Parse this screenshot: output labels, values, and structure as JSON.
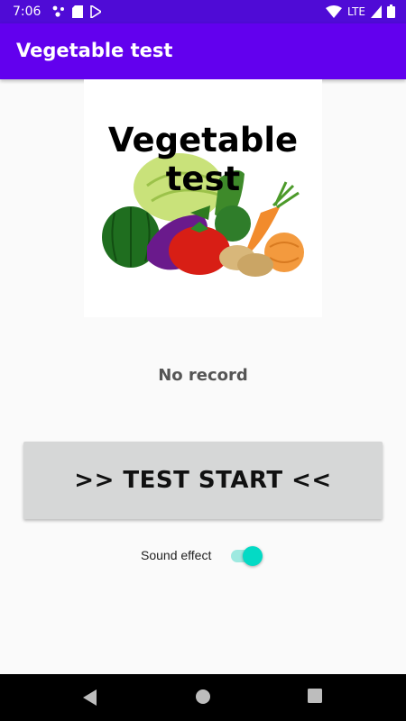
{
  "status_bar": {
    "time": "7:06",
    "network": "LTE"
  },
  "app_bar": {
    "title": "Vegetable test"
  },
  "hero": {
    "title": "Vegetable test"
  },
  "record_text": "No record",
  "start_button": {
    "label": ">> TEST START <<"
  },
  "sound": {
    "label": "Sound effect",
    "enabled": true
  },
  "colors": {
    "status_bar": "#4f0bd6",
    "app_bar": "#6200ee",
    "toggle_accent": "#03dac5"
  }
}
